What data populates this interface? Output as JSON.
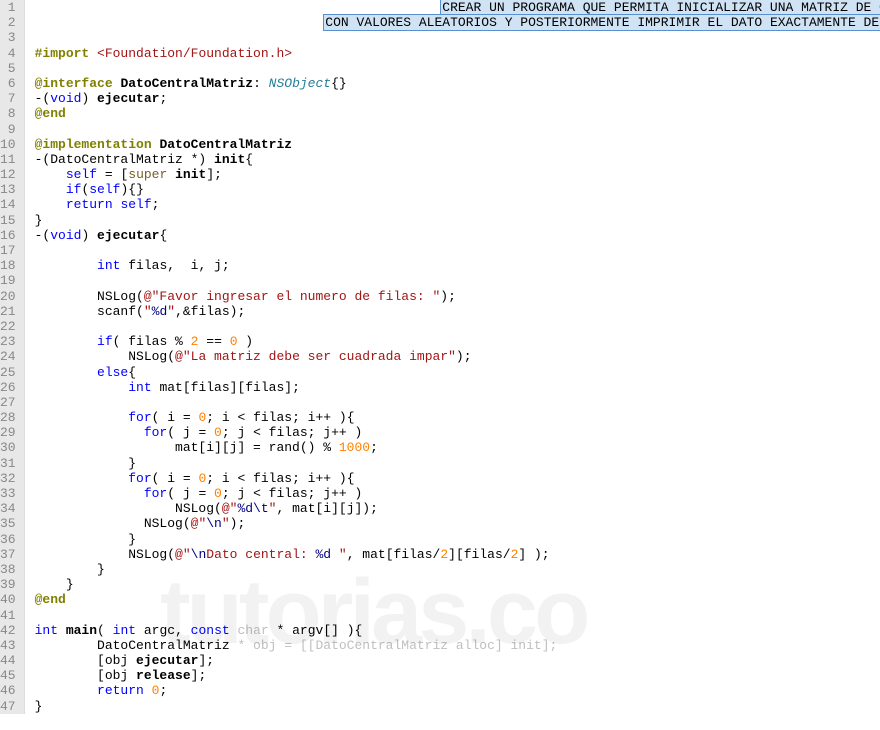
{
  "watermark": "tutorias.co",
  "lines": [
    {
      "n": 1,
      "segs": [
        {
          "t": "                                                    ",
          "c": ""
        },
        {
          "t": "CREAR UN PROGRAMA QUE PERMITA INICIALIZAR UNA MATRIZ DE ORDEN NXN",
          "c": "hlsel"
        }
      ]
    },
    {
      "n": 2,
      "segs": [
        {
          "t": "                                     ",
          "c": ""
        },
        {
          "t": "CON VALORES ALEATORIOS Y POSTERIORMENTE IMPRIMIR EL DATO EXACTAMENTE DEL MEDIO",
          "c": "hlsel"
        }
      ]
    },
    {
      "n": 3,
      "segs": [
        {
          "t": "",
          "c": ""
        }
      ]
    },
    {
      "n": 4,
      "segs": [
        {
          "t": "#import",
          "c": "prep"
        },
        {
          "t": " ",
          "c": ""
        },
        {
          "t": "<Foundation/Foundation.h>",
          "c": "inc"
        }
      ]
    },
    {
      "n": 5,
      "segs": [
        {
          "t": "",
          "c": ""
        }
      ]
    },
    {
      "n": 6,
      "segs": [
        {
          "t": "@interface",
          "c": "atkw"
        },
        {
          "t": " ",
          "c": ""
        },
        {
          "t": "DatoCentralMatriz",
          "c": "clsH"
        },
        {
          "t": ": ",
          "c": ""
        },
        {
          "t": "NSObject",
          "c": "type"
        },
        {
          "t": "{}",
          "c": ""
        }
      ]
    },
    {
      "n": 7,
      "segs": [
        {
          "t": "-(",
          "c": ""
        },
        {
          "t": "void",
          "c": "kw"
        },
        {
          "t": ") ",
          "c": ""
        },
        {
          "t": "ejecutar",
          "c": "func"
        },
        {
          "t": ";",
          "c": ""
        }
      ]
    },
    {
      "n": 8,
      "segs": [
        {
          "t": "@end",
          "c": "atkw"
        }
      ]
    },
    {
      "n": 9,
      "segs": [
        {
          "t": "",
          "c": ""
        }
      ]
    },
    {
      "n": 10,
      "segs": [
        {
          "t": "@implementation",
          "c": "atkw"
        },
        {
          "t": " ",
          "c": ""
        },
        {
          "t": "DatoCentralMatriz",
          "c": "clsH"
        }
      ]
    },
    {
      "n": 11,
      "segs": [
        {
          "t": "-(DatoCentralMatriz *) ",
          "c": ""
        },
        {
          "t": "init",
          "c": "func"
        },
        {
          "t": "{",
          "c": ""
        }
      ]
    },
    {
      "n": 12,
      "segs": [
        {
          "t": "    ",
          "c": ""
        },
        {
          "t": "self",
          "c": "kw"
        },
        {
          "t": " = [",
          "c": ""
        },
        {
          "t": "super",
          "c": "superkw"
        },
        {
          "t": " ",
          "c": ""
        },
        {
          "t": "init",
          "c": "func"
        },
        {
          "t": "];",
          "c": ""
        }
      ]
    },
    {
      "n": 13,
      "segs": [
        {
          "t": "    ",
          "c": ""
        },
        {
          "t": "if",
          "c": "kw"
        },
        {
          "t": "(",
          "c": ""
        },
        {
          "t": "self",
          "c": "kw"
        },
        {
          "t": "){}",
          "c": ""
        }
      ]
    },
    {
      "n": 14,
      "segs": [
        {
          "t": "    ",
          "c": ""
        },
        {
          "t": "return",
          "c": "kw"
        },
        {
          "t": " ",
          "c": ""
        },
        {
          "t": "self",
          "c": "kw"
        },
        {
          "t": ";",
          "c": ""
        }
      ]
    },
    {
      "n": 15,
      "segs": [
        {
          "t": "}",
          "c": ""
        }
      ]
    },
    {
      "n": 16,
      "segs": [
        {
          "t": "-(",
          "c": ""
        },
        {
          "t": "void",
          "c": "kw"
        },
        {
          "t": ") ",
          "c": ""
        },
        {
          "t": "ejecutar",
          "c": "func"
        },
        {
          "t": "{",
          "c": ""
        }
      ]
    },
    {
      "n": 17,
      "segs": [
        {
          "t": "",
          "c": ""
        }
      ]
    },
    {
      "n": 18,
      "segs": [
        {
          "t": "        ",
          "c": ""
        },
        {
          "t": "int",
          "c": "kw"
        },
        {
          "t": " filas,  i, j;",
          "c": ""
        }
      ]
    },
    {
      "n": 19,
      "segs": [
        {
          "t": "",
          "c": ""
        }
      ]
    },
    {
      "n": 20,
      "segs": [
        {
          "t": "        NSLog(",
          "c": ""
        },
        {
          "t": "@\"Favor ingresar el numero de filas: \"",
          "c": "str"
        },
        {
          "t": ");",
          "c": ""
        }
      ]
    },
    {
      "n": 21,
      "segs": [
        {
          "t": "        scanf(",
          "c": ""
        },
        {
          "t": "\"",
          "c": "str"
        },
        {
          "t": "%d",
          "c": "esc"
        },
        {
          "t": "\"",
          "c": "str"
        },
        {
          "t": ",&filas);",
          "c": ""
        }
      ]
    },
    {
      "n": 22,
      "segs": [
        {
          "t": "",
          "c": ""
        }
      ]
    },
    {
      "n": 23,
      "segs": [
        {
          "t": "        ",
          "c": ""
        },
        {
          "t": "if",
          "c": "kw"
        },
        {
          "t": "( filas % ",
          "c": ""
        },
        {
          "t": "2",
          "c": "num"
        },
        {
          "t": " == ",
          "c": ""
        },
        {
          "t": "0",
          "c": "num"
        },
        {
          "t": " )",
          "c": ""
        }
      ]
    },
    {
      "n": 24,
      "segs": [
        {
          "t": "            NSLog(",
          "c": ""
        },
        {
          "t": "@\"La matriz debe ser cuadrada impar\"",
          "c": "str"
        },
        {
          "t": ");",
          "c": ""
        }
      ]
    },
    {
      "n": 25,
      "segs": [
        {
          "t": "        ",
          "c": ""
        },
        {
          "t": "else",
          "c": "kw"
        },
        {
          "t": "{",
          "c": ""
        }
      ]
    },
    {
      "n": 26,
      "segs": [
        {
          "t": "            ",
          "c": ""
        },
        {
          "t": "int",
          "c": "kw"
        },
        {
          "t": " mat[filas][filas];",
          "c": ""
        }
      ]
    },
    {
      "n": 27,
      "segs": [
        {
          "t": "",
          "c": ""
        }
      ]
    },
    {
      "n": 28,
      "segs": [
        {
          "t": "            ",
          "c": ""
        },
        {
          "t": "for",
          "c": "kw"
        },
        {
          "t": "( i = ",
          "c": ""
        },
        {
          "t": "0",
          "c": "num"
        },
        {
          "t": "; i < filas; i++ ){",
          "c": ""
        }
      ]
    },
    {
      "n": 29,
      "segs": [
        {
          "t": "              ",
          "c": ""
        },
        {
          "t": "for",
          "c": "kw"
        },
        {
          "t": "( j = ",
          "c": ""
        },
        {
          "t": "0",
          "c": "num"
        },
        {
          "t": "; j < filas; j++ )",
          "c": ""
        }
      ]
    },
    {
      "n": 30,
      "segs": [
        {
          "t": "                  mat[i][j] = rand() % ",
          "c": ""
        },
        {
          "t": "1000",
          "c": "num"
        },
        {
          "t": ";",
          "c": ""
        }
      ]
    },
    {
      "n": 31,
      "segs": [
        {
          "t": "            }",
          "c": ""
        }
      ]
    },
    {
      "n": 32,
      "segs": [
        {
          "t": "            ",
          "c": ""
        },
        {
          "t": "for",
          "c": "kw"
        },
        {
          "t": "( i = ",
          "c": ""
        },
        {
          "t": "0",
          "c": "num"
        },
        {
          "t": "; i < filas; i++ ){",
          "c": ""
        }
      ]
    },
    {
      "n": 33,
      "segs": [
        {
          "t": "              ",
          "c": ""
        },
        {
          "t": "for",
          "c": "kw"
        },
        {
          "t": "( j = ",
          "c": ""
        },
        {
          "t": "0",
          "c": "num"
        },
        {
          "t": "; j < filas; j++ )",
          "c": ""
        }
      ]
    },
    {
      "n": 34,
      "segs": [
        {
          "t": "                  NSLog(",
          "c": ""
        },
        {
          "t": "@\"",
          "c": "str"
        },
        {
          "t": "%d\\t",
          "c": "esc"
        },
        {
          "t": "\"",
          "c": "str"
        },
        {
          "t": ", mat[i][j]);",
          "c": ""
        }
      ]
    },
    {
      "n": 35,
      "segs": [
        {
          "t": "              NSLog(",
          "c": ""
        },
        {
          "t": "@\"",
          "c": "str"
        },
        {
          "t": "\\n",
          "c": "esc"
        },
        {
          "t": "\"",
          "c": "str"
        },
        {
          "t": ");",
          "c": ""
        }
      ]
    },
    {
      "n": 36,
      "segs": [
        {
          "t": "            }",
          "c": ""
        }
      ]
    },
    {
      "n": 37,
      "segs": [
        {
          "t": "            NSLog(",
          "c": ""
        },
        {
          "t": "@\"",
          "c": "str"
        },
        {
          "t": "\\n",
          "c": "esc"
        },
        {
          "t": "Dato central: ",
          "c": "str"
        },
        {
          "t": "%d",
          "c": "esc"
        },
        {
          "t": " \"",
          "c": "str"
        },
        {
          "t": ", mat[filas/",
          "c": ""
        },
        {
          "t": "2",
          "c": "num"
        },
        {
          "t": "][filas/",
          "c": ""
        },
        {
          "t": "2",
          "c": "num"
        },
        {
          "t": "] );",
          "c": ""
        }
      ]
    },
    {
      "n": 38,
      "segs": [
        {
          "t": "        }",
          "c": ""
        }
      ]
    },
    {
      "n": 39,
      "segs": [
        {
          "t": "    }",
          "c": ""
        }
      ]
    },
    {
      "n": 40,
      "segs": [
        {
          "t": "@end",
          "c": "atkw"
        }
      ]
    },
    {
      "n": 41,
      "segs": [
        {
          "t": "",
          "c": ""
        }
      ]
    },
    {
      "n": 42,
      "segs": [
        {
          "t": "int",
          "c": "kw"
        },
        {
          "t": " ",
          "c": ""
        },
        {
          "t": "main",
          "c": "func"
        },
        {
          "t": "( ",
          "c": ""
        },
        {
          "t": "int",
          "c": "kw"
        },
        {
          "t": " argc, ",
          "c": ""
        },
        {
          "t": "const",
          "c": "kw"
        },
        {
          "t": " ",
          "c": ""
        },
        {
          "t": "char",
          "c": "dimmed"
        },
        {
          "t": " * argv[] ){",
          "c": ""
        }
      ]
    },
    {
      "n": 43,
      "segs": [
        {
          "t": "        DatoCentralMatriz ",
          "c": ""
        },
        {
          "t": "* obj = [[DatoCentralMatriz alloc] init];",
          "c": "dimmed"
        }
      ]
    },
    {
      "n": 44,
      "segs": [
        {
          "t": "        [obj ",
          "c": ""
        },
        {
          "t": "ejecutar",
          "c": "func"
        },
        {
          "t": "];",
          "c": ""
        }
      ]
    },
    {
      "n": 45,
      "segs": [
        {
          "t": "        [obj ",
          "c": ""
        },
        {
          "t": "release",
          "c": "func"
        },
        {
          "t": "];",
          "c": ""
        }
      ]
    },
    {
      "n": 46,
      "segs": [
        {
          "t": "        ",
          "c": ""
        },
        {
          "t": "return",
          "c": "kw"
        },
        {
          "t": " ",
          "c": ""
        },
        {
          "t": "0",
          "c": "num"
        },
        {
          "t": ";",
          "c": ""
        }
      ]
    },
    {
      "n": 47,
      "segs": [
        {
          "t": "}",
          "c": ""
        }
      ]
    }
  ]
}
